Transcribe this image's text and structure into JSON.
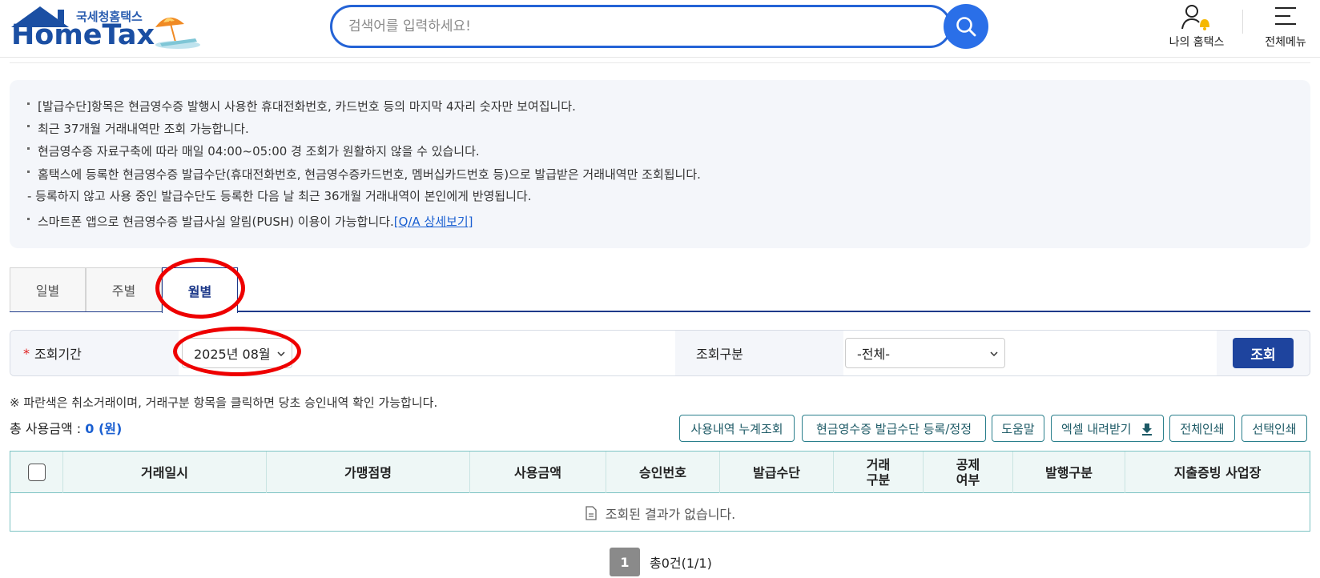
{
  "header": {
    "logo_sub": "국세청홈택스",
    "logo_main": "HomeTax",
    "search_placeholder": "검색어를 입력하세요!",
    "my_hometax": "나의 홈택스",
    "all_menu": "전체메뉴"
  },
  "notice": {
    "items": [
      "[발급수단]항목은 현금영수증 발행시 사용한 휴대전화번호, 카드번호 등의 마지막 4자리 숫자만 보여집니다.",
      "최근 37개월 거래내역만 조회 가능합니다.",
      "현금영수증 자료구축에 따라 매일 04:00~05:00 경 조회가 원활하지 않을 수 있습니다.",
      "홈택스에 등록한 현금영수증 발급수단(휴대전화번호, 현금영수증카드번호, 멤버십카드번호 등)으로 발급받은 거래내역만 조회됩니다."
    ],
    "sub_item": "- 등록하지 않고 사용 중인 발급수단도 등록한 다음 날 최근 36개월 거래내역이 본인에게 반영됩니다.",
    "push_text": "스마트폰 앱으로 현금영수증 발급사실 알림(PUSH) 이용이 가능합니다.",
    "push_link": "[Q/A 상세보기]"
  },
  "tabs": [
    "일별",
    "주별",
    "월별"
  ],
  "active_tab": "월별",
  "filter": {
    "period_label": "조회기간",
    "required_mark": "*",
    "period_value": "2025년 08월",
    "type_label": "조회구분",
    "type_value": "-전체-",
    "query_button": "조회"
  },
  "hint": "※ 파란색은 취소거래이며, 거래구분 항목을 클릭하면 당초 승인내역 확인 가능합니다.",
  "total": {
    "label": "총 사용금액 : ",
    "amount": "0 (원)"
  },
  "actions": {
    "cumulative": "사용내역 누계조회",
    "register": "현금영수증 발급수단 등록/정정",
    "help": "도움말",
    "excel": "엑셀 내려받기",
    "print_all": "전체인쇄",
    "print_selected": "선택인쇄"
  },
  "table": {
    "columns": [
      "거래일시",
      "가맹점명",
      "사용금액",
      "승인번호",
      "발급수단",
      "거래\n구분",
      "공제\n여부",
      "발행구분",
      "지출증빙 사업장"
    ],
    "empty_message": "조회된 결과가 없습니다."
  },
  "pagination": {
    "current_page": "1",
    "info": "총0건(1/1)"
  },
  "colors": {
    "brand": "#1b4fa3",
    "search_border": "#2463d6",
    "query_button": "#1e449e",
    "table_border": "#7cc3c3",
    "annotation": "#ee0000"
  }
}
